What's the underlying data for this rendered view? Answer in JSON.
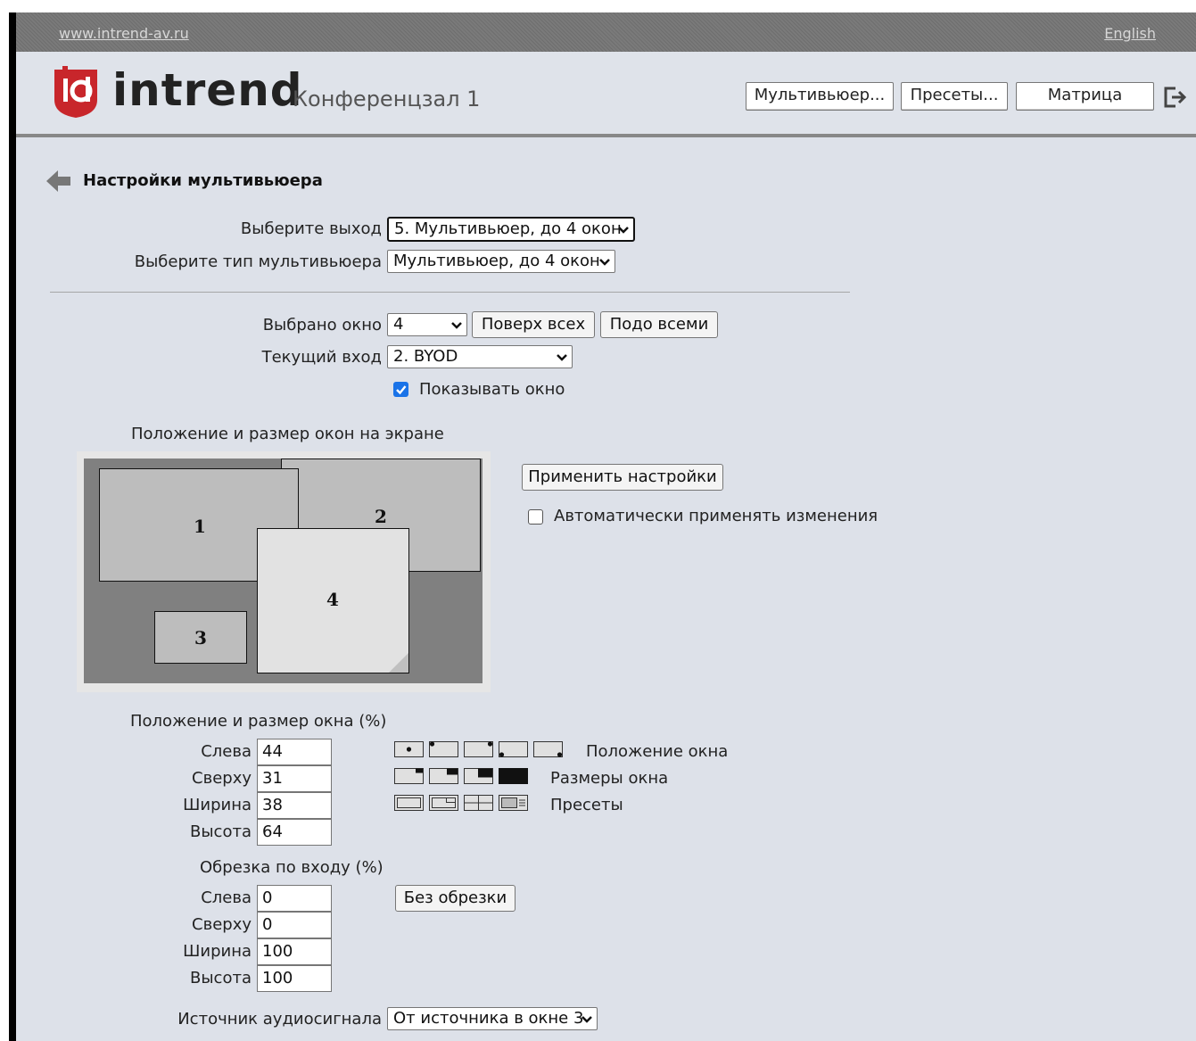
{
  "topbar": {
    "site_link": "www.intrend-av.ru",
    "language_link": "English"
  },
  "header": {
    "logo_text": "intrend",
    "room_title": "Конференцзал 1",
    "buttons": {
      "multiviewer": "Мультивьюер...",
      "presets": "Пресеты...",
      "matrix": "Матрица"
    },
    "brand_color": "#c8262b"
  },
  "page": {
    "title": "Настройки мультивьюера",
    "output": {
      "label": "Выберите выход",
      "value": "5. Мультивьюер, до 4 окон"
    },
    "mv_type": {
      "label": "Выберите тип мультивьюера",
      "value": "Мультивьюер, до 4 окон"
    },
    "window": {
      "label": "Выбрано окно",
      "value": "4",
      "on_top": "Поверх всех",
      "below_all": "Подо всеми"
    },
    "input": {
      "label": "Текущий вход",
      "value": "2. BYOD"
    },
    "show_window": {
      "label": "Показывать окно",
      "checked": true
    },
    "layout_title": "Положение и размер окон на экране",
    "windows": [
      {
        "id": "1",
        "label": "1"
      },
      {
        "id": "2",
        "label": "2"
      },
      {
        "id": "3",
        "label": "3"
      },
      {
        "id": "4",
        "label": "4"
      }
    ],
    "apply_button": "Применить настройки",
    "auto_apply": {
      "label": "Автоматически применять изменения",
      "checked": false
    },
    "pos_size": {
      "title": "Положение и размер окна (%)",
      "left": {
        "label": "Слева",
        "value": "44"
      },
      "top": {
        "label": "Сверху",
        "value": "31"
      },
      "width": {
        "label": "Ширина",
        "value": "38"
      },
      "height": {
        "label": "Высота",
        "value": "64"
      }
    },
    "icon_rows": {
      "position": "Положение окна",
      "sizes": "Размеры окна",
      "presets": "Пресеты"
    },
    "crop": {
      "title": "Обрезка по входу (%)",
      "left": {
        "label": "Слева",
        "value": "0"
      },
      "top": {
        "label": "Сверху",
        "value": "0"
      },
      "width": {
        "label": "Ширина",
        "value": "100"
      },
      "height": {
        "label": "Высота",
        "value": "100"
      },
      "no_crop": "Без обрезки"
    },
    "audio": {
      "label": "Источник аудиосигнала",
      "value": "От источника в окне 3"
    }
  }
}
